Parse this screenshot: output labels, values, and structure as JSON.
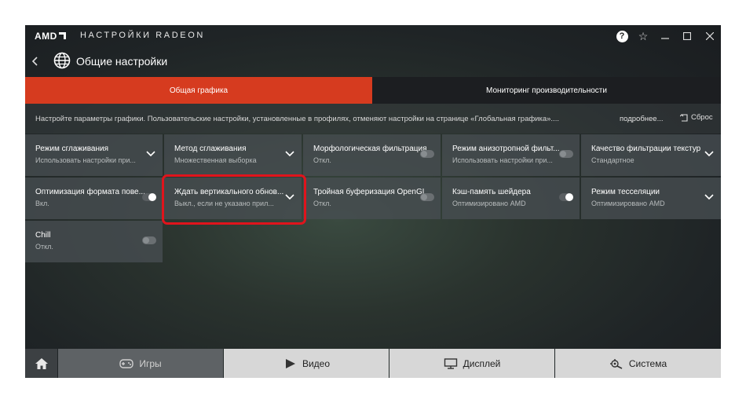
{
  "titlebar": {
    "logo": "AMD",
    "title": "НАСТРОЙКИ RADEON"
  },
  "header": {
    "title": "Общие настройки"
  },
  "tabs": [
    {
      "label": "Общая графика",
      "active": true
    },
    {
      "label": "Мониторинг производительности",
      "active": false
    }
  ],
  "description": {
    "text": "Настройте параметры графики. Пользовательские настройки, установленные в профилях, отменяют настройки на странице «Глобальная графика»....",
    "more_label": "подробнее...",
    "reset_label": "Сброс"
  },
  "settings": [
    {
      "label": "Режим сглаживания",
      "value": "Использовать настройки при...",
      "control": "dropdown"
    },
    {
      "label": "Метод сглаживания",
      "value": "Множественная выборка",
      "control": "dropdown"
    },
    {
      "label": "Морфологическая фильтрация",
      "value": "Откл.",
      "control": "toggle-off"
    },
    {
      "label": "Режим анизотропной фильт...",
      "value": "Использовать настройки при...",
      "control": "toggle-off"
    },
    {
      "label": "Качество фильтрации текстур",
      "value": "Стандартное",
      "control": "dropdown"
    },
    {
      "label": "Оптимизация формата пове...",
      "value": "Вкл.",
      "control": "toggle-on"
    },
    {
      "label": "Ждать вертикального обнов...",
      "value": "Выкл., если не указано прил...",
      "control": "dropdown"
    },
    {
      "label": "Тройная буферизация OpenGL",
      "value": "Откл.",
      "control": "toggle-off"
    },
    {
      "label": "Кэш-память шейдера",
      "value": "Оптимизировано AMD",
      "control": "toggle-on"
    },
    {
      "label": "Режим тесселяции",
      "value": "Оптимизировано AMD",
      "control": "dropdown"
    },
    {
      "label": "Chill",
      "value": "Откл.",
      "control": "toggle-off"
    }
  ],
  "bottom_nav": {
    "games": "Игры",
    "video": "Видео",
    "display": "Дисплей",
    "system": "Система"
  },
  "colors": {
    "accent": "#d63b1f",
    "highlight": "#e0141c"
  }
}
